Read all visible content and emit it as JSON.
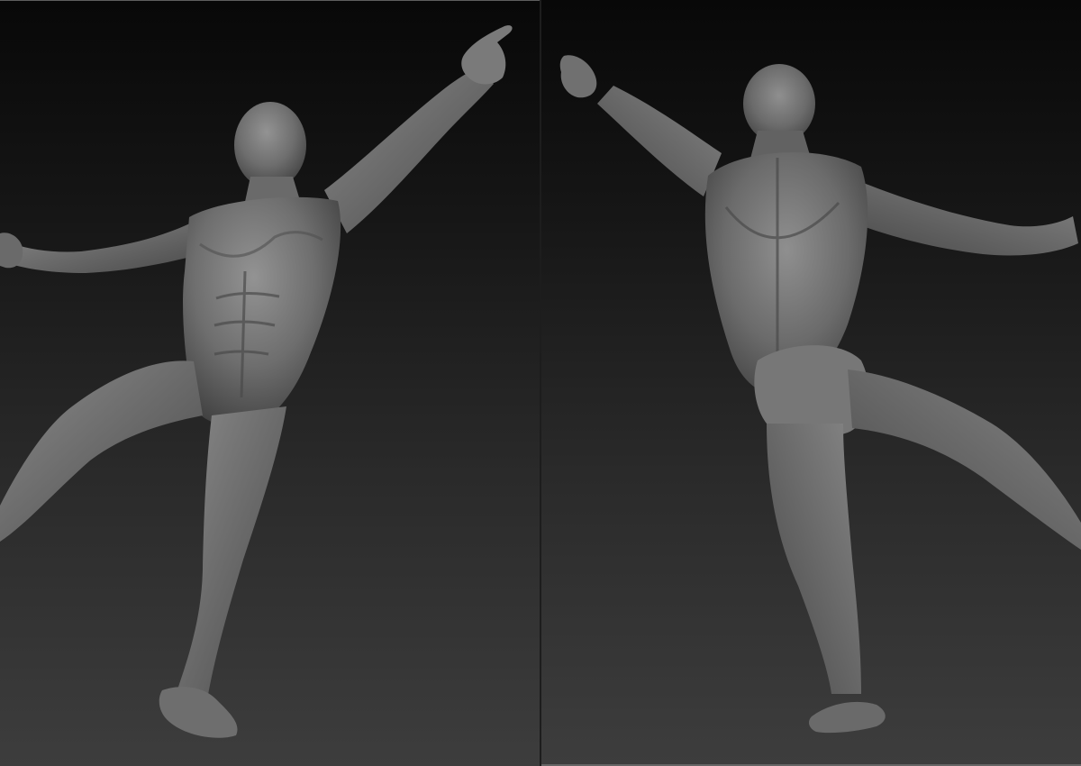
{
  "scene": {
    "viewports": [
      {
        "name": "front-view",
        "subject": "sculpt-front"
      },
      {
        "name": "back-view",
        "subject": "sculpt-back"
      }
    ],
    "colors": {
      "bg_top": "#080808",
      "bg_bottom": "#3d3d3d",
      "clay_light": "#8c8c8c",
      "clay_mid": "#6c6c6c",
      "clay_dark": "#3e3e3e"
    }
  }
}
